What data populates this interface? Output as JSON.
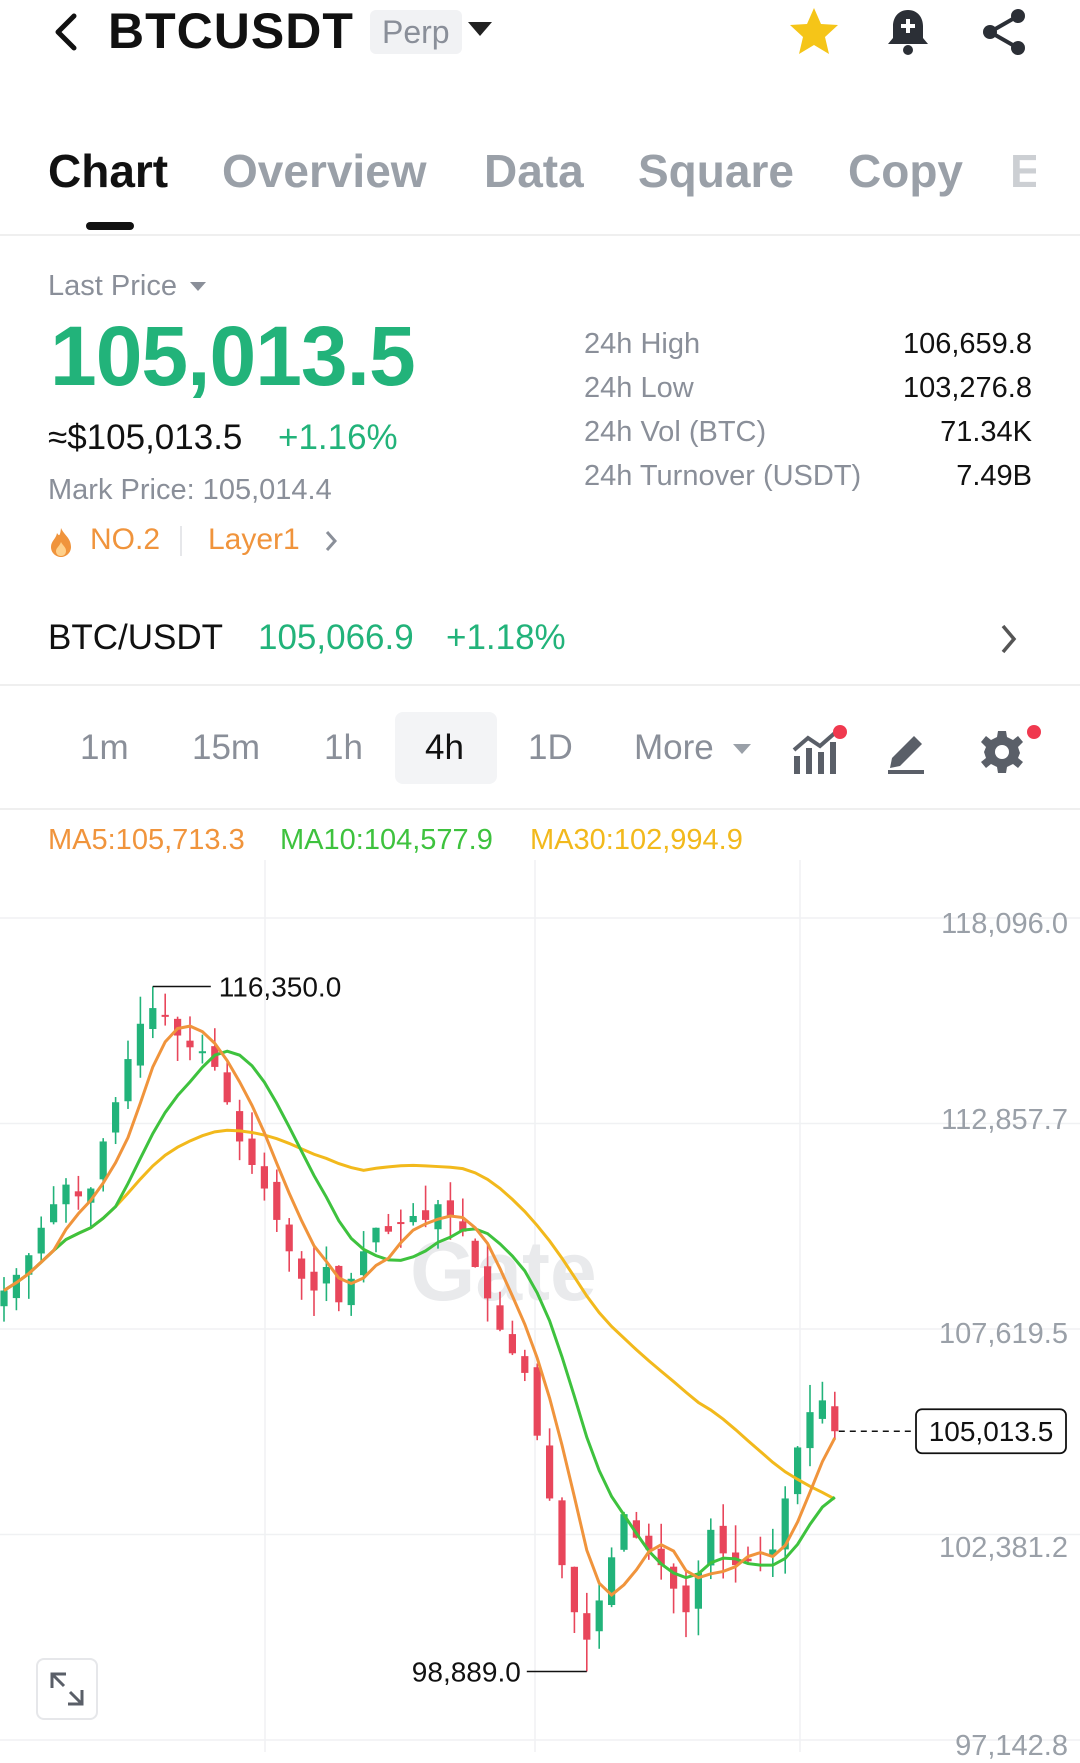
{
  "header": {
    "symbol": "BTCUSDT",
    "contract_type": "Perp",
    "icons": [
      "back-arrow-icon",
      "caret-down-icon",
      "star-icon",
      "bell-plus-icon",
      "share-icon"
    ],
    "star_color": "#f5c518"
  },
  "tabs": [
    {
      "label": "Chart",
      "active": true
    },
    {
      "label": "Overview"
    },
    {
      "label": "Data"
    },
    {
      "label": "Square"
    },
    {
      "label": "Copy"
    },
    {
      "label": "E"
    }
  ],
  "price": {
    "last_price_label": "Last Price",
    "last_price": "105,013.5",
    "usd_equiv": "≈$105,013.5",
    "change_pct": "+1.16%",
    "mark_price": "Mark Price:  105,014.4",
    "rank": "NO.2",
    "category": "Layer1",
    "up_color": "#22b37a"
  },
  "stats": [
    {
      "label": "24h High",
      "value": "106,659.8"
    },
    {
      "label": "24h Low",
      "value": "103,276.8"
    },
    {
      "label": "24h Vol (BTC)",
      "value": "71.34K"
    },
    {
      "label": "24h Turnover (USDT)",
      "value": "7.49B"
    }
  ],
  "spot": {
    "pair": "BTC/USDT",
    "price": "105,066.9",
    "change": "+1.18%"
  },
  "intervals": {
    "items": [
      "1m",
      "15m",
      "1h",
      "4h",
      "1D"
    ],
    "active": "4h",
    "more_label": "More"
  },
  "indicators": {
    "ma5": "MA5:105,713.3",
    "ma10": "MA10:104,577.9",
    "ma30": "MA30:102,994.9",
    "ma5_color": "#f0943c",
    "ma10_color": "#3ec23e",
    "ma30_color": "#f2b91c"
  },
  "chart_data": {
    "type": "candlestick",
    "y_ticks": [
      "118,096.0",
      "112,857.7",
      "107,619.5",
      "102,381.2",
      "97,142.8"
    ],
    "ylim": [
      97142.8,
      118096.0
    ],
    "high_label": "116,350.0",
    "low_label": "98,889.0",
    "high_value": 116350.0,
    "low_value": 98889.0,
    "current_price_label": "105,013.5",
    "current_price": 105013.5,
    "watermark": "Gate",
    "up_color": "#22b37a",
    "down_color": "#e8465b",
    "close_path": [
      108600,
      109000,
      109500,
      110200,
      110800,
      111300,
      111000,
      111200,
      112400,
      113400,
      114500,
      115400,
      115800,
      115600,
      115100,
      114800,
      114700,
      114300,
      113400,
      112400,
      111800,
      111200,
      110400,
      109600,
      108900,
      108600,
      109200,
      108300,
      108900,
      109600,
      110200,
      110100,
      110300,
      110500,
      110400,
      110800,
      110500,
      110100,
      109200,
      108400,
      107600,
      107000,
      106500,
      104900,
      103300,
      101600,
      100400,
      99700,
      100700,
      101800,
      102900,
      102300,
      102000,
      101600,
      101000,
      100400,
      101400,
      102500,
      101900,
      101600,
      101700,
      101900,
      102000,
      103300,
      104600,
      105500,
      105800,
      105013.5
    ],
    "ma_series": [
      {
        "name": "MA5",
        "value": 105713.3
      },
      {
        "name": "MA10",
        "value": 104577.9
      },
      {
        "name": "MA30",
        "value": 102994.9
      }
    ]
  }
}
